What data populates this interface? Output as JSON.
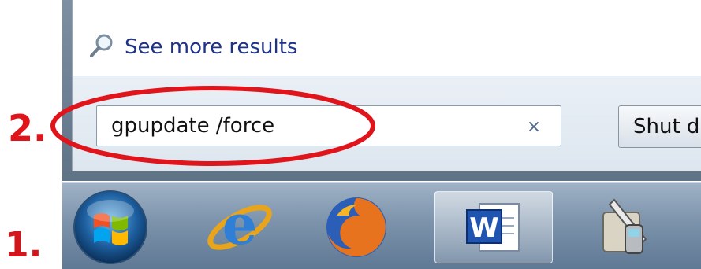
{
  "annotations": {
    "step_two": "2.",
    "step_one": "1.",
    "highlight_color": "#e0141b"
  },
  "start_menu": {
    "see_more_results": "See more results",
    "search_value": "gpupdate /force",
    "clear_glyph": "×",
    "shutdown_label": "Shut d"
  },
  "taskbar": {
    "items": [
      {
        "name": "start-orb",
        "icon": "windows-logo-icon"
      },
      {
        "name": "internet-explorer",
        "icon": "internet-explorer-icon"
      },
      {
        "name": "firefox",
        "icon": "firefox-icon"
      },
      {
        "name": "word",
        "icon": "microsoft-word-icon",
        "active": true
      },
      {
        "name": "pen-and-mobile-app",
        "icon": "pen-mobile-icon"
      }
    ]
  }
}
